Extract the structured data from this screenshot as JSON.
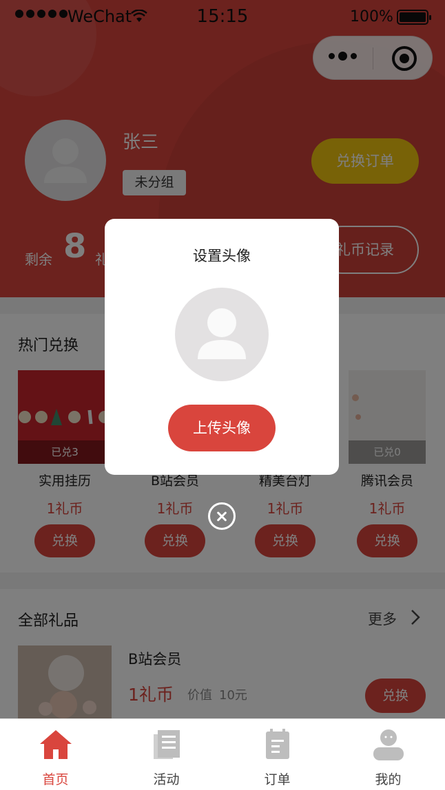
{
  "status_bar": {
    "carrier": "WeChat",
    "time": "15:15",
    "battery": "100%"
  },
  "profile": {
    "name": "张三",
    "group": "未分组",
    "exchange_order_label": "兑换订单",
    "remaining_label": "剩余",
    "remaining_value": "8",
    "remaining_unit": "礼",
    "coin_record_label": "礼币记录"
  },
  "hot_section": {
    "title": "热门兑换",
    "items": [
      {
        "name": "实用挂历",
        "price": "1礼币",
        "badge": "已兑3",
        "button": "兑换"
      },
      {
        "name": "B站会员",
        "price": "1礼币",
        "badge": "",
        "button": "兑换"
      },
      {
        "name": "精美台灯",
        "price": "1礼币",
        "badge": "",
        "button": "兑换"
      },
      {
        "name": "腾讯会员",
        "price": "1礼币",
        "badge": "已兑0",
        "button": "兑换"
      }
    ]
  },
  "all_gifts": {
    "title": "全部礼品",
    "more_label": "更多",
    "item": {
      "name": "B站会员",
      "price": "1礼币",
      "value_label": "价值",
      "value": "10元",
      "button": "兑换"
    }
  },
  "tabbar": {
    "tabs": [
      {
        "label": "首页",
        "icon": "home-icon",
        "active": true
      },
      {
        "label": "活动",
        "icon": "activity-icon",
        "active": false
      },
      {
        "label": "订单",
        "icon": "order-icon",
        "active": false
      },
      {
        "label": "我的",
        "icon": "profile-icon",
        "active": false
      }
    ]
  },
  "modal": {
    "title": "设置头像",
    "upload_label": "上传头像"
  },
  "colors": {
    "accent": "#d9453d",
    "gold": "#f1c40f",
    "mask": "rgba(0,0,0,0.5)"
  }
}
